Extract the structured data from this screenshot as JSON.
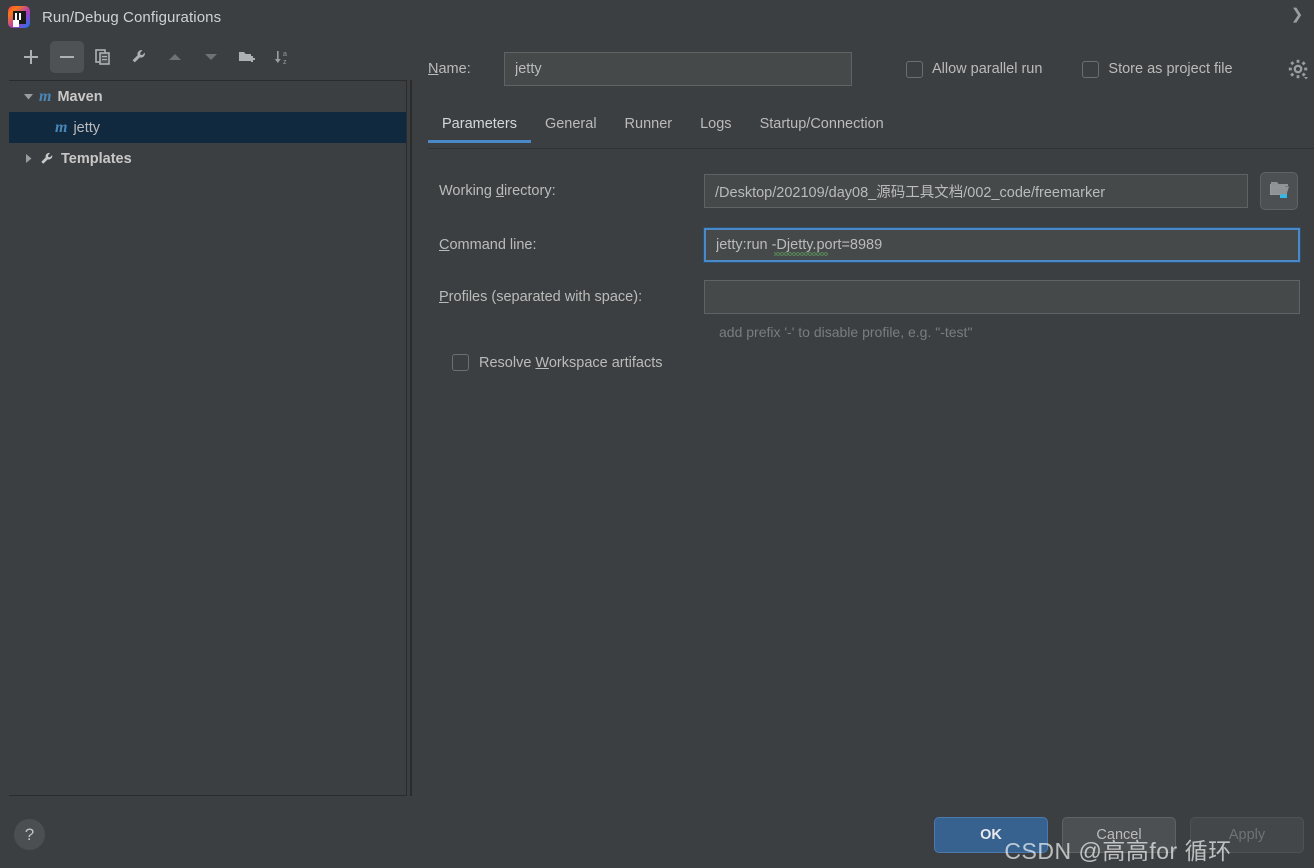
{
  "window": {
    "title": "Run/Debug Configurations",
    "app_icon": "intellij-idea-logo",
    "close_glyph": "❯"
  },
  "toolbar": {
    "buttons": [
      {
        "name": "add",
        "icon": "plus-icon",
        "pressed": false
      },
      {
        "name": "remove",
        "icon": "minus-icon",
        "pressed": true
      },
      {
        "name": "copy",
        "icon": "copy-icon",
        "pressed": false
      },
      {
        "name": "edit-templates",
        "icon": "wrench-icon",
        "pressed": false
      },
      {
        "name": "move-up",
        "icon": "arrow-up-icon",
        "pressed": false
      },
      {
        "name": "move-down",
        "icon": "arrow-down-icon",
        "pressed": false
      },
      {
        "name": "new-folder",
        "icon": "folder-add-icon",
        "pressed": false
      },
      {
        "name": "sort-alphabetically",
        "icon": "sort-az-icon",
        "pressed": false
      }
    ]
  },
  "tree": {
    "nodes": [
      {
        "label": "Maven",
        "icon": "maven-icon",
        "twisty": "expanded",
        "level": 1,
        "selected": false,
        "bold": true
      },
      {
        "label": "jetty",
        "icon": "maven-icon",
        "twisty": "none",
        "level": 2,
        "selected": true,
        "bold": false
      },
      {
        "label": "Templates",
        "icon": "wrench-icon",
        "twisty": "collapsed",
        "level": 1,
        "selected": false,
        "bold": true
      }
    ]
  },
  "header": {
    "name_label": "Name:",
    "name_mnemonic": "N",
    "name_label_rest": "ame:",
    "name_value": "jetty",
    "name_placeholder": "",
    "checkboxes": [
      {
        "label": "Allow parallel run",
        "mnemonic_tail": "n",
        "checked": false,
        "name": "allow-parallel-run"
      },
      {
        "label": "Store as project file",
        "mnemonic_head": "S",
        "checked": false,
        "name": "store-as-project-file"
      }
    ],
    "gear_icon": "gear-dropdown-icon"
  },
  "tabs": [
    {
      "label": "Parameters",
      "active": true
    },
    {
      "label": "General",
      "active": false
    },
    {
      "label": "Runner",
      "active": false
    },
    {
      "label": "Logs",
      "active": false
    },
    {
      "label": "Startup/Connection",
      "active": false
    }
  ],
  "form": {
    "working_directory": {
      "label_head": "Working ",
      "label_mnemonic": "d",
      "label_tail": "irectory:",
      "value": "/Desktop/202109/day08_源码工具文档/002_code/freemarker",
      "placeholder": "",
      "inline_icon": "folder-open-icon",
      "browse_icon": "folder-macro-icon"
    },
    "command_line": {
      "label_head": "",
      "label_mnemonic": "C",
      "label_tail": "ommand line:",
      "value": "jetty:run -Djetty.port=8989",
      "placeholder": "",
      "focused": true,
      "spellcheck_underline": true
    },
    "profiles": {
      "label_head": "",
      "label_mnemonic": "P",
      "label_tail": "rofiles (separated with space):",
      "value": "",
      "placeholder": "",
      "hint": "add prefix '-' to disable profile, e.g. \"-test\""
    },
    "resolve_workspace_artifacts": {
      "label_head": "Resolve ",
      "label_mnemonic": "W",
      "label_tail": "orkspace artifacts",
      "checked": false
    }
  },
  "footer": {
    "help_label": "?",
    "ok_label": "OK",
    "cancel_label": "Cancel",
    "apply_label": "Apply",
    "apply_enabled": false
  },
  "watermark": "CSDN @高高for 循环",
  "colors": {
    "background": "#3c3f41",
    "field_background": "#45494a",
    "selection": "#10293f",
    "accent": "#4a88c7",
    "primary_button": "#37618e",
    "text": "#bbbbbb",
    "maven_icon": "#4a87b8",
    "badge_cyan": "#35b8e8"
  }
}
